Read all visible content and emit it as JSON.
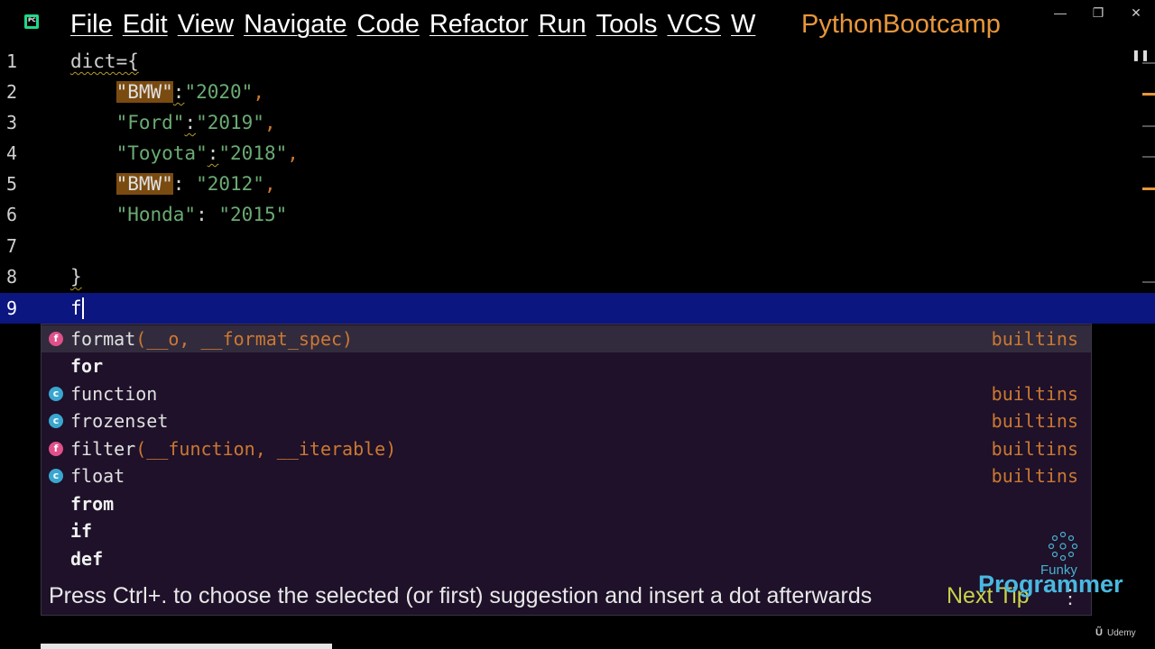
{
  "titlebar": {
    "app_icon": "pycharm-icon",
    "menu": [
      "File",
      "Edit",
      "View",
      "Navigate",
      "Code",
      "Refactor",
      "Run",
      "Tools",
      "VCS",
      "W"
    ],
    "project_name": "PythonBootcamp",
    "window_buttons": [
      "minimize-icon",
      "restore-icon",
      "close-icon"
    ]
  },
  "editor": {
    "lines": [
      {
        "num": "1",
        "text": "dict={"
      },
      {
        "num": "2",
        "key": "\"BMW\"",
        "sep": ":",
        "value": "\"2020\"",
        "end": ","
      },
      {
        "num": "3",
        "key": "\"Ford\"",
        "sep": ":",
        "value": "\"2019\"",
        "end": ","
      },
      {
        "num": "4",
        "key": "\"Toyota\"",
        "sep": ":",
        "value": "\"2018\"",
        "end": ","
      },
      {
        "num": "5",
        "key": "\"BMW\"",
        "sep": ": ",
        "value": "\"2012\"",
        "end": ","
      },
      {
        "num": "6",
        "key": "\"Honda\"",
        "sep": ": ",
        "value": "\"2015\"",
        "end": ""
      },
      {
        "num": "7",
        "text": ""
      },
      {
        "num": "8",
        "text": "}"
      },
      {
        "num": "9",
        "text": "f"
      }
    ]
  },
  "completion": {
    "items": [
      {
        "kind": "f",
        "name": "format",
        "params": "(__o, __format_spec)",
        "source": "builtins"
      },
      {
        "kind": "",
        "name": "for",
        "params": "",
        "source": ""
      },
      {
        "kind": "c",
        "name": "function",
        "params": "",
        "source": "builtins"
      },
      {
        "kind": "c",
        "name": "frozenset",
        "params": "",
        "source": "builtins"
      },
      {
        "kind": "f",
        "name": "filter",
        "params": "(__function, __iterable)",
        "source": "builtins"
      },
      {
        "kind": "c",
        "name": "float",
        "params": "",
        "source": "builtins"
      },
      {
        "kind": "",
        "name": "from",
        "params": "",
        "source": ""
      },
      {
        "kind": "",
        "name": "if",
        "params": "",
        "source": ""
      },
      {
        "kind": "",
        "name": "def",
        "params": "",
        "source": ""
      }
    ],
    "tip": "Press Ctrl+. to choose the selected (or first) suggestion and insert a dot afterwards",
    "next_tip": "Next Tip",
    "more": "⋮"
  },
  "watermark": {
    "funky": "Funky",
    "programmer": "Programmer",
    "udemy": "Udemy"
  },
  "colors": {
    "string": "#6aab73",
    "punctuation": "#cc7832",
    "current_line": "#0b1680",
    "match_highlight": "#7a4b10",
    "popup_bg": "#1e1129",
    "project_name": "#e8973a"
  }
}
